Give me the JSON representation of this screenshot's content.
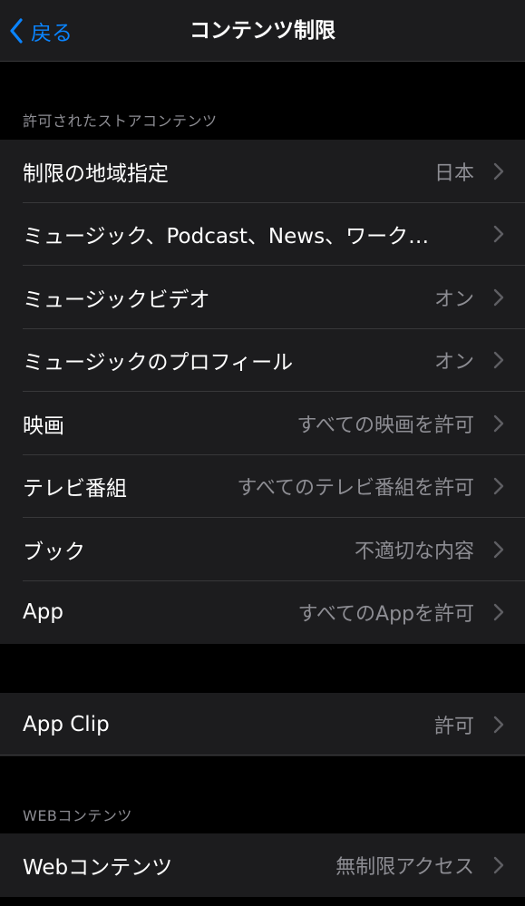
{
  "nav": {
    "back_label": "戻る",
    "title": "コンテンツ制限"
  },
  "sections": {
    "store": {
      "header": "許可されたストアコンテンツ",
      "rows": [
        {
          "label": "制限の地域指定",
          "value": "日本"
        },
        {
          "label": "ミュージック、Podcast、News、ワーク…",
          "value": ""
        },
        {
          "label": "ミュージックビデオ",
          "value": "オン"
        },
        {
          "label": "ミュージックのプロフィール",
          "value": "オン"
        },
        {
          "label": "映画",
          "value": "すべての映画を許可"
        },
        {
          "label": "テレビ番組",
          "value": "すべてのテレビ番組を許可"
        },
        {
          "label": "ブック",
          "value": "不適切な内容"
        },
        {
          "label": "App",
          "value": "すべてのAppを許可"
        }
      ]
    },
    "appclip": {
      "rows": [
        {
          "label": "App Clip",
          "value": "許可"
        }
      ]
    },
    "web": {
      "header": "WEBコンテンツ",
      "rows": [
        {
          "label": "Webコンテンツ",
          "value": "無制限アクセス"
        }
      ]
    }
  },
  "colors": {
    "background": "#000000",
    "cell": "#1c1c1e",
    "accent": "#0a84ff",
    "secondary_text": "#8d8d93",
    "separator": "#38383a"
  }
}
